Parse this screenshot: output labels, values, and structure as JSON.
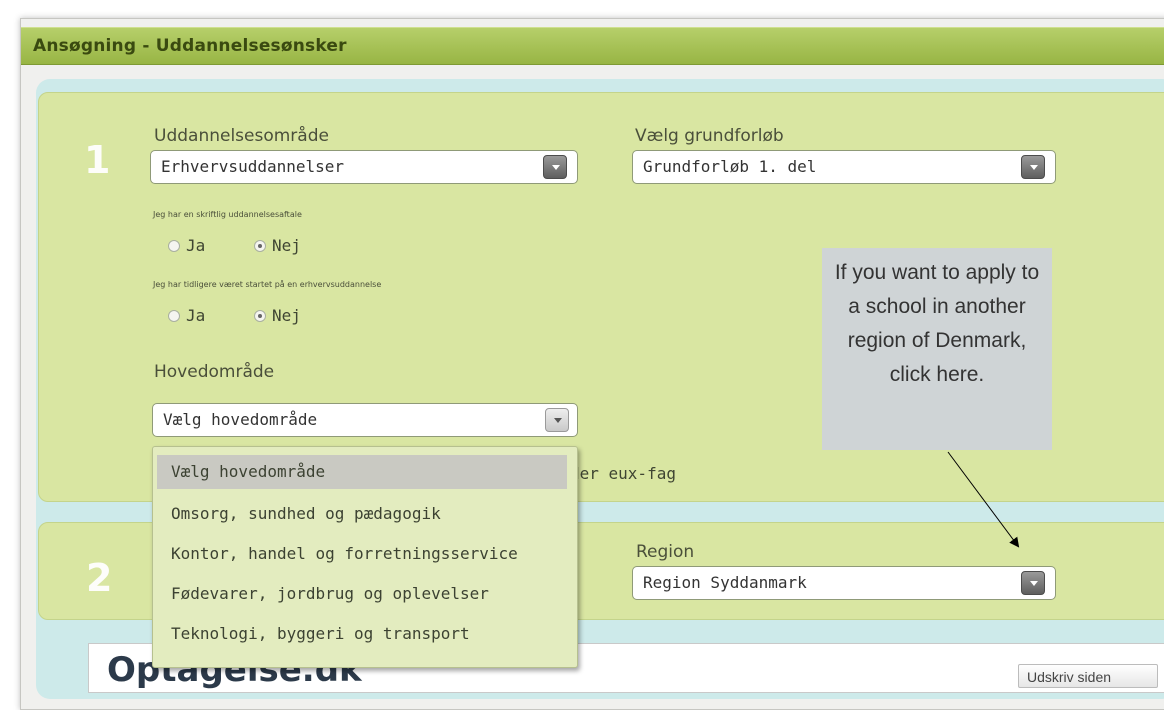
{
  "header": {
    "title": "Ansøgning - Uddannelsesønsker"
  },
  "section1": {
    "number": "1",
    "field_uddannelse": {
      "label": "Uddannelsesområde",
      "value": "Erhvervsuddannelser"
    },
    "field_grundforloeb": {
      "label": "Vælg grundforløb",
      "value": "Grundforløb 1. del"
    },
    "q_aftale": {
      "label": "Jeg har en skriftlig uddannelsesaftale",
      "yes": "Ja",
      "no": "Nej",
      "selected": "Nej"
    },
    "q_startet": {
      "label": "Jeg har tidligere været startet på en erhvervsuddannelse",
      "yes": "Ja",
      "no": "Nej",
      "selected": "Nej"
    },
    "field_hovedomraade": {
      "label": "Hovedområde",
      "value": "Vælg hovedområde",
      "options": [
        "Vælg hovedområde",
        "Omsorg, sundhed og pædagogik",
        "Kontor, handel og forretningsservice",
        "Fødevarer, jordbrug og oplevelser",
        "Teknologi, byggeri og transport"
      ]
    },
    "cutoff_text": "der eux-fag"
  },
  "section2": {
    "number": "2",
    "field_region": {
      "label": "Region",
      "value": "Region Syddanmark"
    }
  },
  "callout": {
    "text": "If you want to apply to a school in another region of Denmark, click here."
  },
  "footer": {
    "logo": "Optagelse.dk",
    "print_button": "Udskriv siden"
  }
}
